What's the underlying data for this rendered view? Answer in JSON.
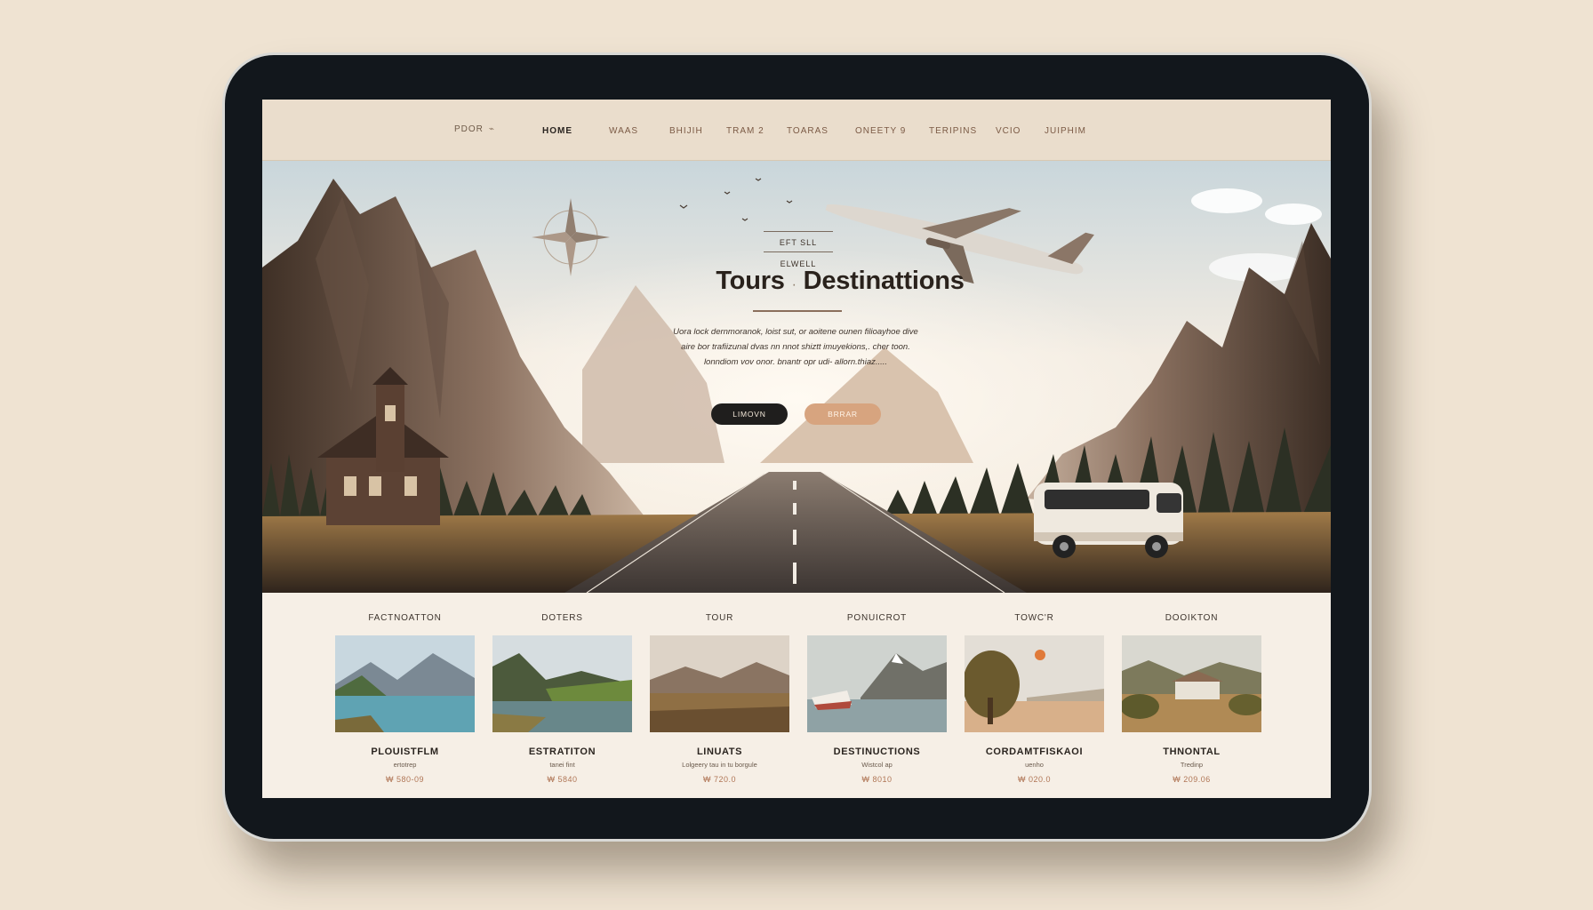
{
  "nav": {
    "logo": "PDOR",
    "items": [
      "HOME",
      "WAAS",
      "BHIJIH",
      "TRAM 2",
      "TOARAS",
      "ONEETY 9",
      "TERIPINS",
      "VCIO",
      "JUIPHIM"
    ]
  },
  "hero": {
    "eyebrow": "EFT SLL ELWELL",
    "title_part1": "Tours",
    "separator": "·",
    "title_part2": "Destinattions",
    "text": "Uora lock dernmoranok, loist sut, or aoitene ounen filioayhoe dive aire bor trafiizunal dvas nn nnot shiztt imuyekions,. cher toon. lonndiom vov onor. bnantr opr udi- allorn.thiaz.....",
    "btn_primary": "LIMOVN",
    "btn_secondary": "BRRAR"
  },
  "cards": [
    {
      "category": "FACTNOATTON",
      "title": "PLOUISTFLM",
      "sub": "ertotrep",
      "price": "₩ 580-09",
      "image": "lake-mountains"
    },
    {
      "category": "DOTERS",
      "title": "ESTRATITON",
      "sub": "tanei fint",
      "price": "₩ 5840",
      "image": "river-valley"
    },
    {
      "category": "TOUR",
      "title": "LINUATS",
      "sub": "Lolgeery tau in tu borgule",
      "price": "₩ 720.0",
      "image": "plains-hills"
    },
    {
      "category": "PONUICROT",
      "title": "DESTINUCTIONS",
      "sub": "Wistcol ap",
      "price": "₩ 8010",
      "image": "boat-fjord"
    },
    {
      "category": "TOWC'R",
      "title": "CORDAMTFISKAOI",
      "sub": "uenho",
      "price": "₩ 020.0",
      "image": "tree-desert"
    },
    {
      "category": "DOOIKTON",
      "title": "THNONTAL",
      "sub": "Tredinp",
      "price": "₩ 209.06",
      "image": "villa-hills"
    }
  ]
}
